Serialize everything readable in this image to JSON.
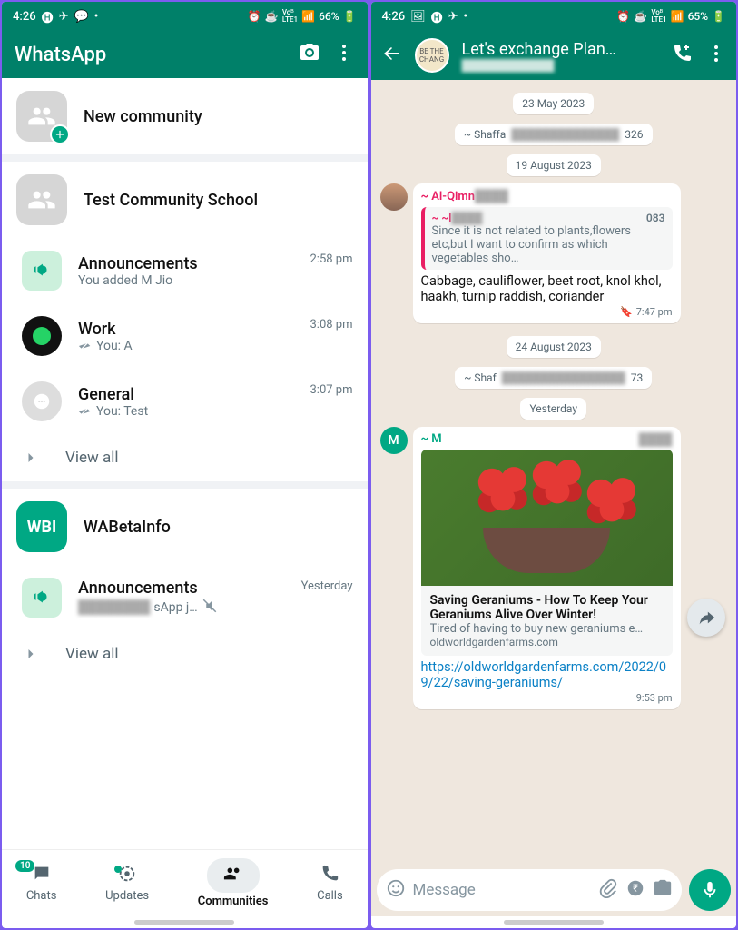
{
  "left": {
    "status": {
      "time": "4:26",
      "icons": "⏰ ☕ ᵛᵒᵇ ᴸᵀᴱ¹ ₁₁ll 66%",
      "battery": "66%"
    },
    "appTitle": "WhatsApp",
    "newCommunity": "New community",
    "communities": [
      {
        "name": "Test Community School",
        "icon": "group"
      },
      {
        "channels": [
          {
            "name": "Announcements",
            "preview": "You added M Jio",
            "time": "2:58 pm",
            "type": "ann"
          },
          {
            "name": "Work",
            "preview": "You: A",
            "time": "3:08 pm",
            "type": "whatsapp",
            "checks": true
          },
          {
            "name": "General",
            "preview": "You: Test",
            "time": "3:07 pm",
            "type": "bubble",
            "checks": true
          }
        ],
        "viewAll": "View all"
      },
      {
        "name": "WABetaInfo",
        "icon": "wbi",
        "logo": "WBI"
      },
      {
        "channels2": [
          {
            "name": "Announcements",
            "preview": "              sApp j…",
            "time": "Yesterday",
            "type": "ann",
            "muted": true
          }
        ],
        "viewAll2": "View all"
      }
    ],
    "nav": [
      {
        "label": "Chats",
        "badge": "10"
      },
      {
        "label": "Updates",
        "dot": true
      },
      {
        "label": "Communities",
        "active": true
      },
      {
        "label": "Calls"
      }
    ]
  },
  "right": {
    "status": {
      "time": "4:26",
      "battery": "65%"
    },
    "chatTitle": "Let's exchange Plan…",
    "chips": [
      "23 May 2023",
      "19 August 2023",
      "24 August 2023",
      "Yesterday"
    ],
    "sys1": {
      "name": "~ Shaffa",
      "tail": "326"
    },
    "sys2": {
      "name": "~ Shaf",
      "tail": "73"
    },
    "msg1": {
      "sender": "~ Al-Qimn",
      "quoteSender": "~ ~l",
      "quoteTail": "083",
      "quoteBody": "Since it is not related to plants,flowers etc,but I want to confirm as which vegetables sho…",
      "body": "Cabbage, cauliflower, beet root, knol khol, haakh, turnip raddish, coriander",
      "time": "7:47 pm"
    },
    "msg2": {
      "sender": "~ M",
      "linkTitle": "Saving Geraniums - How To Keep Your Geraniums Alive Over Winter!",
      "linkDesc": "Tired of having to buy new geraniums e…",
      "linkDomain": "oldworldgardenfarms.com",
      "url": "https://oldworldgardenfarms.com/2022/09/22/saving-geraniums/",
      "time": "9:53 pm",
      "avLetter": "M"
    },
    "input": {
      "placeholder": "Message"
    }
  }
}
